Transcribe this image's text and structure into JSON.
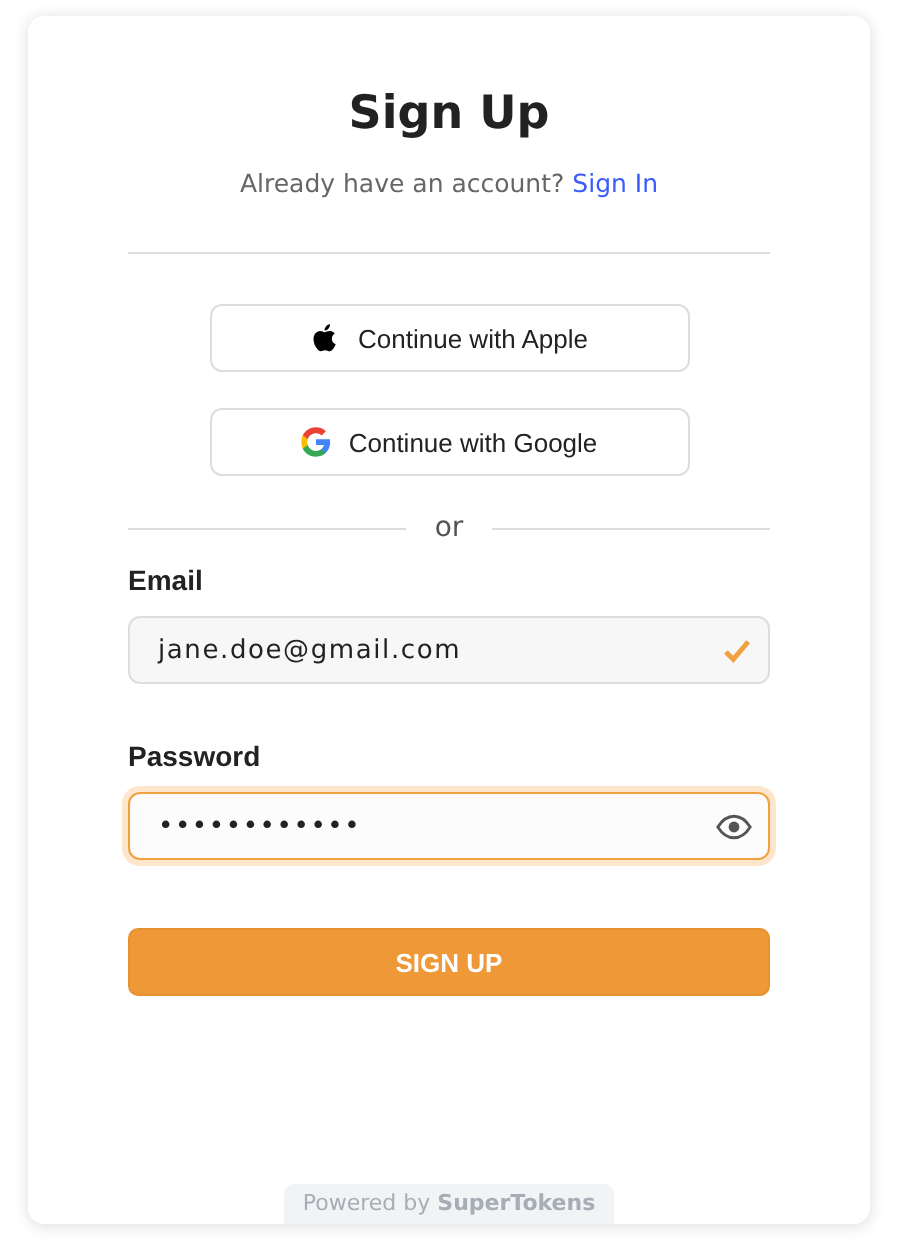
{
  "title": "Sign Up",
  "subtitle": {
    "text": "Already have an account?",
    "link": "Sign In"
  },
  "providers": [
    {
      "kind": "apple",
      "label": "Continue with Apple"
    },
    {
      "kind": "google",
      "label": "Continue with Google"
    }
  ],
  "divider": "or",
  "fields": [
    {
      "label": "Email",
      "value": "jane.doe@gmail.com",
      "valid": true,
      "focused": false,
      "kind": "email"
    },
    {
      "label": "Password",
      "value": "••••••••••••",
      "valid": false,
      "focused": true,
      "kind": "password"
    }
  ],
  "submit": "SIGN UP",
  "footer": "Powered by **SuperTokens**"
}
